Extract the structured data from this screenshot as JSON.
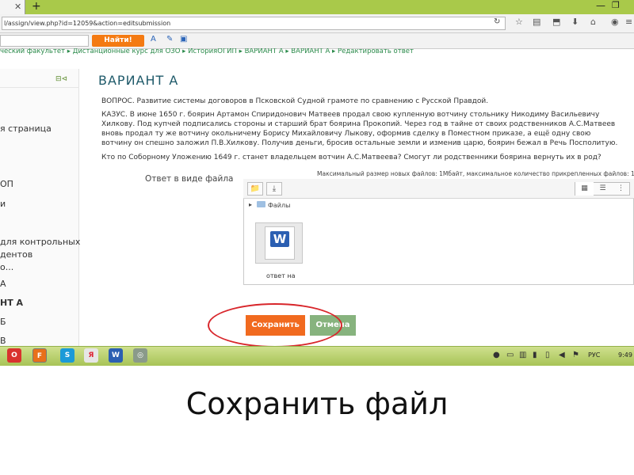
{
  "browser": {
    "tab_close": "✕",
    "new_tab": "+",
    "window_min": "—",
    "window_max": "❐",
    "url": "l/assign/view.php?id=12059&action=editsubmission",
    "search_button": "Найти!"
  },
  "breadcrumb": "ческий факультет  ▸  Дистанционные курс для ОЗО  ▸  ИсторияОГИП  ▸  ВАРИАНТ А  ▸  ВАРИАНТ А  ▸  Редактировать ответ",
  "sidebar": {
    "items": [
      "я страница",
      "ОП",
      "и",
      "для контрольных",
      "дентов",
      "о...",
      "А",
      "НТ А",
      "Б",
      "В"
    ]
  },
  "main": {
    "title": "ВАРИАНТ А",
    "question": "ВОПРОС. Развитие системы договоров в Псковской Судной грамоте по сравнению с Русской Правдой.",
    "case_lines": [
      "КАЗУС. В июне 1650 г. боярин Артамон Спиридонович Матвеев продал свою купленную вотчину стольнику Никодиму Васильевичу",
      "Хилкову. Под купчей подписались стороны и старший брат боярина Прокопий. Через год в тайне от своих родственников А.С.Матвеев",
      "вновь продал ту же вотчину окольничему Борису Михайловичу Лыкову, оформив сделку в Поместном приказе, а ещё одну свою",
      "вотчину он спешно заложил П.В.Хилкову. Получив деньги, бросив остальные земли и изменив царю, боярин бежал в Речь Посполитую."
    ],
    "final_question": "Кто по Соборному Уложению 1649 г. станет владельцем вотчин А.С.Матвеева? Смогут ли родственники боярина вернуть их в род?",
    "answer_label": "Ответ в виде файла",
    "max_size": "Максимальный размер новых файлов: 1Мбайт, максимальное количество прикрепленных файлов: 1",
    "folder_label": "Файлы",
    "file_name": "ответ на",
    "save_button": "Сохранить",
    "cancel_button": "Отмена"
  },
  "taskbar": {
    "language": "РУС",
    "time": "9:49"
  },
  "caption": "Сохранить файл",
  "colors": {
    "accent_orange": "#f16a1f",
    "cancel_green": "#87b37e",
    "highlight_red": "#d8262b",
    "title_teal": "#1f5a6a"
  }
}
